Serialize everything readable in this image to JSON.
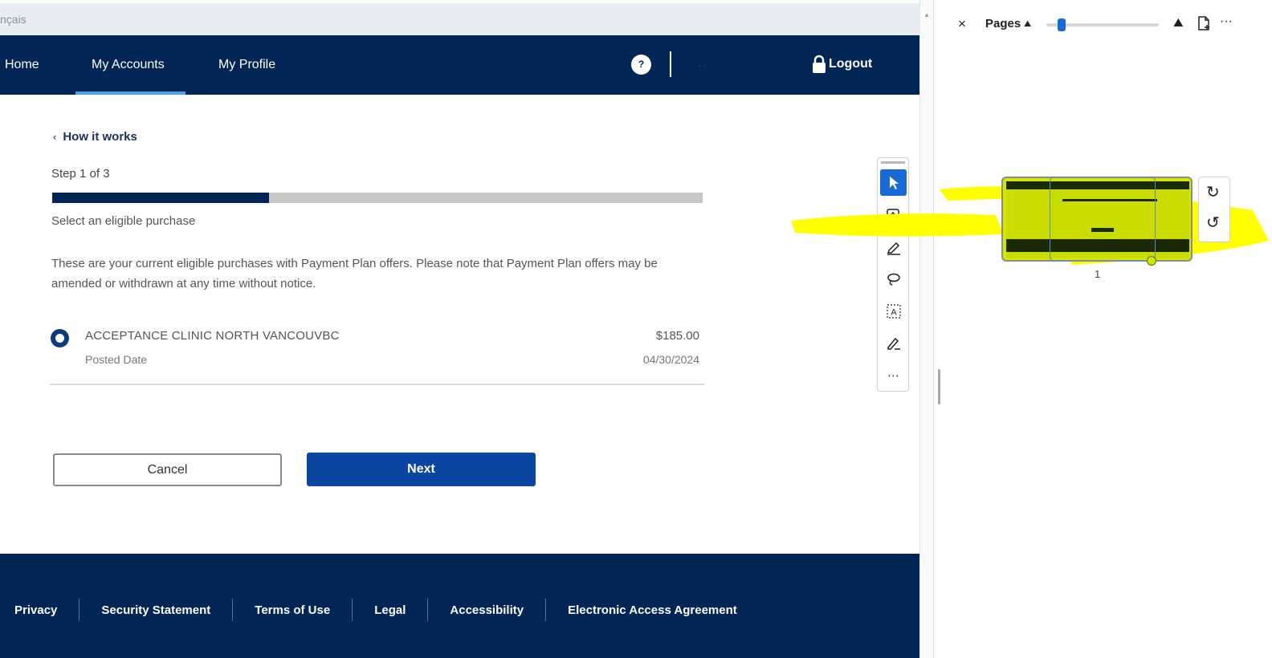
{
  "language_bar": {
    "text": "nçais"
  },
  "nav": {
    "items": [
      "Home",
      "My Accounts",
      "My Profile"
    ],
    "active": "My Accounts",
    "help_label": "?",
    "logout_label": "Logout"
  },
  "back_link": "How it works",
  "step": {
    "label": "Step 1 of 3",
    "progress": 0.333
  },
  "section_label": "Select an eligible purchase",
  "description": "These are your current eligible purchases with Payment Plan offers. Please note that Payment Plan offers may be amended or withdrawn at any time without notice.",
  "purchase": {
    "merchant": "ACCEPTANCE CLINIC NORTH VANCOUVBC",
    "amount": "$185.00",
    "posted_label": "Posted Date",
    "posted_date": "04/30/2024",
    "selected": true
  },
  "buttons": {
    "cancel": "Cancel",
    "next": "Next"
  },
  "footer": {
    "links": [
      "Privacy",
      "Security Statement",
      "Terms of Use",
      "Legal",
      "Accessibility",
      "Electronic Access Agreement"
    ]
  },
  "pages_panel": {
    "title": "Pages",
    "close_label": "×",
    "more_label": "···",
    "page_number": "1",
    "zoom_level": 0.1
  },
  "colors": {
    "nav_bg": "#012554",
    "accent_underline": "#4fa3e0",
    "next_button": "#0c46a3",
    "highlight": "#ffff00",
    "tool_active": "#1a6ad6"
  }
}
